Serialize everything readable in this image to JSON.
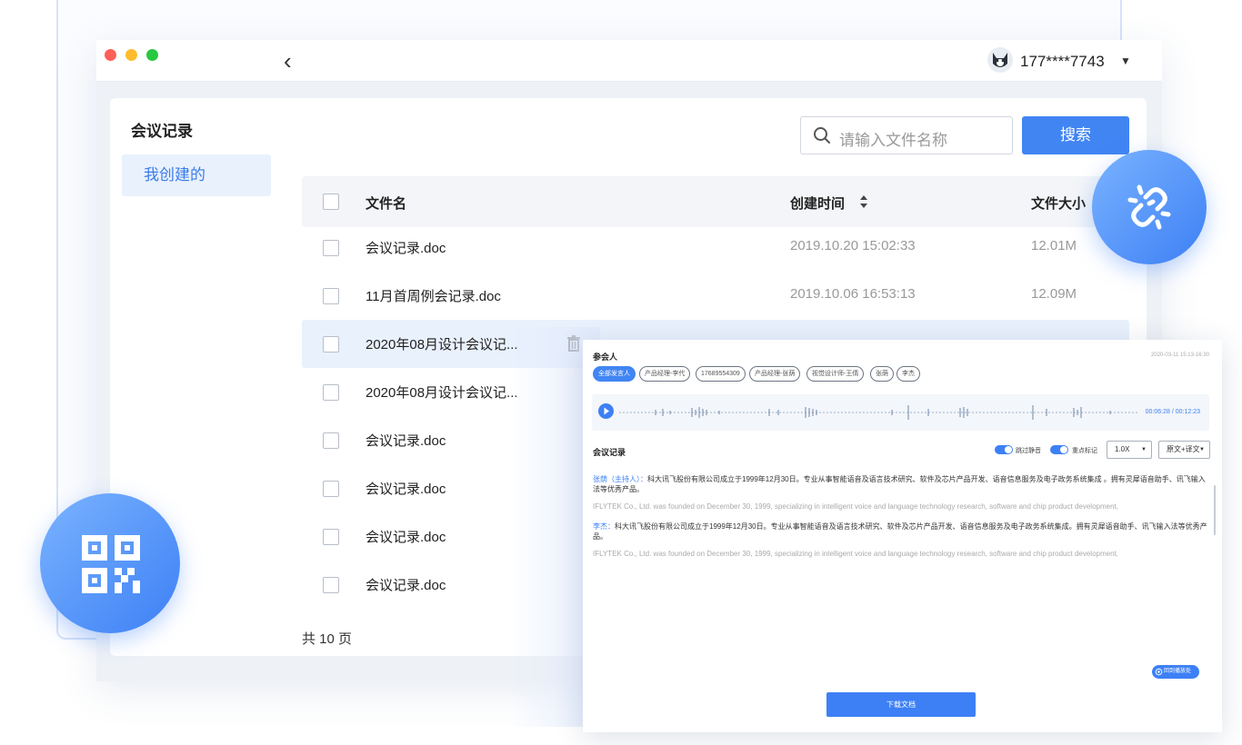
{
  "user": {
    "phone": "177****7743",
    "caret": "▼"
  },
  "sidebar": {
    "title": "会议记录",
    "active_item": "我创建的"
  },
  "search": {
    "placeholder": "请输入文件名称",
    "button": "搜索"
  },
  "table": {
    "headers": {
      "name": "文件名",
      "time": "创建时间",
      "size": "文件大小"
    },
    "rows": [
      {
        "name": "会议记录.doc",
        "time": "2019.10.20  15:02:33",
        "size": "12.01M"
      },
      {
        "name": "11月首周例会记录.doc",
        "time": "2019.10.06  16:53:13",
        "size": "12.09M"
      },
      {
        "name": "2020年08月设计会议记...",
        "time": "",
        "size": ""
      },
      {
        "name": "2020年08月设计会议记...",
        "time": "",
        "size": ""
      },
      {
        "name": "会议记录.doc",
        "time": "",
        "size": ""
      },
      {
        "name": "会议记录.doc",
        "time": "",
        "size": ""
      },
      {
        "name": "会议记录.doc",
        "time": "",
        "size": ""
      },
      {
        "name": "会议记录.doc",
        "time": "",
        "size": ""
      }
    ],
    "pager": "共 10 页"
  },
  "panel": {
    "participants_label": "参会人",
    "timestamp": "2020-03-11  15:13-16:30",
    "tags": [
      "全部发言人",
      "产品经理-李代",
      "17689554309",
      "产品经理-张荫",
      "视觉设计师-王倩",
      "张荫",
      "李杰"
    ],
    "audio_time": "00:06:28 / 00:12:23",
    "record_title": "会议记录",
    "toggle_skip": "跳过静音",
    "toggle_mark": "重点标记",
    "speed": "1.0X",
    "mode": "原文+译文",
    "p1_speaker": "张荫（主持人）：",
    "p1_text": "科大讯飞股份有限公司成立于1999年12月30日。专业从事智能语音及语言技术研究、软件及芯片产品开发、语音信息服务及电子政务系统集成 。拥有灵犀语音助手、讯飞输入法等优秀产品。",
    "p1_en": "IFLYTEK Co., Ltd. was founded on December 30, 1999, specializing in intelligent voice and language technology research, software and chip product development,",
    "p2_speaker": "李杰：",
    "p2_text": "科大讯飞股份有限公司成立于1999年12月30日。专业从事智能语音及语言技术研究、软件及芯片产品开发、语音信息服务及电子政务系统集成。拥有灵犀语音助手、讯飞输入法等优秀产品。",
    "p2_en": "IFLYTEK Co., Ltd. was founded on December 30, 1999, specializing in intelligent voice and language technology research, software and chip product development,",
    "locate_btn": "回到播放处",
    "download": "下载文档"
  },
  "colors": {
    "accent": "#4185f3",
    "selected_row": "#e9f1fd"
  },
  "icons": [
    "back-chevron-icon",
    "avatar-icon",
    "search-icon",
    "sort-icon",
    "trash-icon",
    "link-icon",
    "qr-code-icon",
    "play-icon",
    "locate-icon"
  ]
}
